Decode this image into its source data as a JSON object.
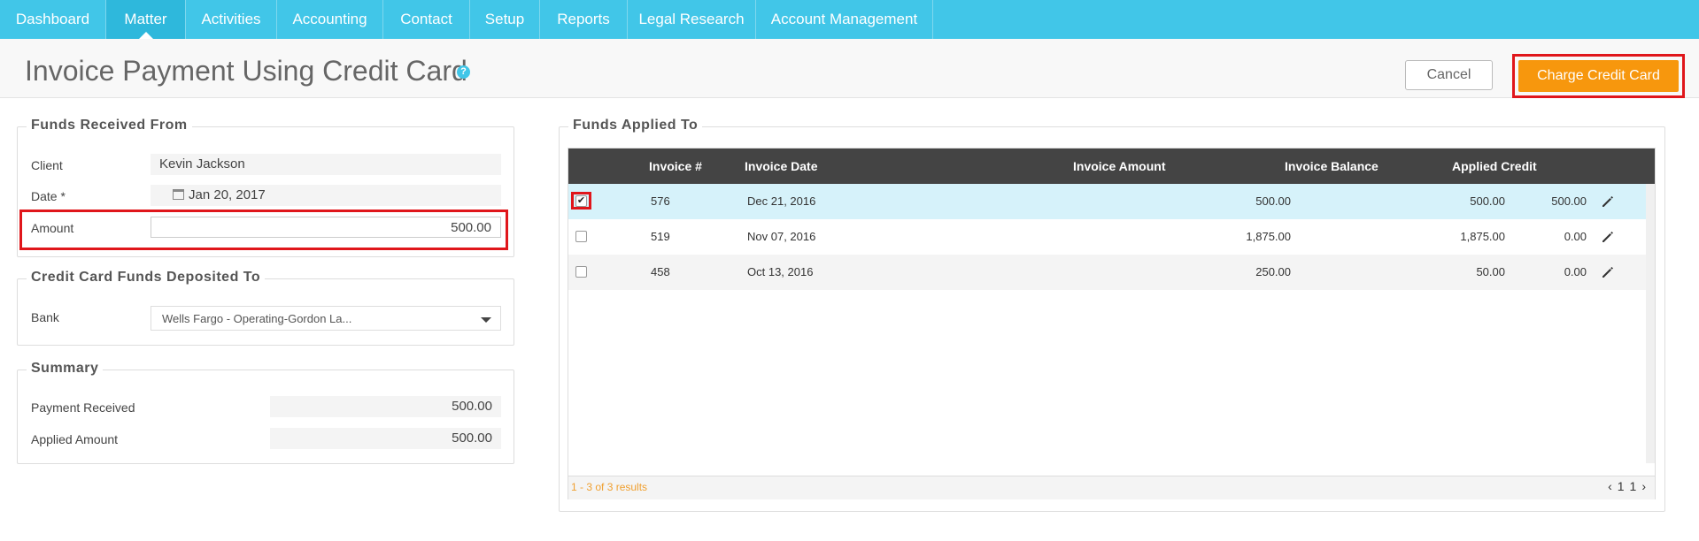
{
  "nav": {
    "items": [
      {
        "label": "Dashboard",
        "active": false
      },
      {
        "label": "Matter",
        "active": true
      },
      {
        "label": "Activities",
        "active": false
      },
      {
        "label": "Accounting",
        "active": false
      },
      {
        "label": "Contact",
        "active": false
      },
      {
        "label": "Setup",
        "active": false
      },
      {
        "label": "Reports",
        "active": false
      },
      {
        "label": "Legal Research",
        "active": false
      },
      {
        "label": "Account Management",
        "active": false
      }
    ]
  },
  "header": {
    "title": "Invoice Payment Using Credit Card",
    "help_icon": "?",
    "cancel_label": "Cancel",
    "charge_label": "Charge Credit Card"
  },
  "funds_received": {
    "legend": "Funds Received From",
    "client_label": "Client",
    "client_value": "Kevin Jackson",
    "date_label": "Date *",
    "date_value": "Jan 20, 2017",
    "amount_label": "Amount",
    "amount_value": "500.00"
  },
  "deposited_to": {
    "legend": "Credit Card Funds Deposited To",
    "bank_label": "Bank",
    "bank_value": "Wells Fargo - Operating-Gordon La..."
  },
  "summary": {
    "legend": "Summary",
    "payment_received_label": "Payment Received",
    "payment_received_value": "500.00",
    "applied_amount_label": "Applied Amount",
    "applied_amount_value": "500.00"
  },
  "funds_applied": {
    "legend": "Funds Applied To",
    "columns": [
      "Invoice #",
      "Invoice Date",
      "Invoice Amount",
      "Invoice Balance",
      "Applied Credit"
    ],
    "rows": [
      {
        "checked": true,
        "check": "✔",
        "invoice": "576",
        "date": "Dec 21, 2016",
        "amount": "500.00",
        "balance": "500.00",
        "applied": "500.00"
      },
      {
        "checked": false,
        "check": "",
        "invoice": "519",
        "date": "Nov 07, 2016",
        "amount": "1,875.00",
        "balance": "1,875.00",
        "applied": "0.00"
      },
      {
        "checked": false,
        "check": "",
        "invoice": "458",
        "date": "Oct 13, 2016",
        "amount": "250.00",
        "balance": "50.00",
        "applied": "0.00"
      }
    ],
    "results_text": "1 - 3 of 3 results",
    "pager": {
      "prev": "‹",
      "first": "1",
      "current": "1",
      "next": "›"
    }
  },
  "colors": {
    "nav_bg": "#41c6e8",
    "charge_button": "#f7970d",
    "highlight_border": "#e0161b",
    "selected_row": "#d6f2fa"
  }
}
